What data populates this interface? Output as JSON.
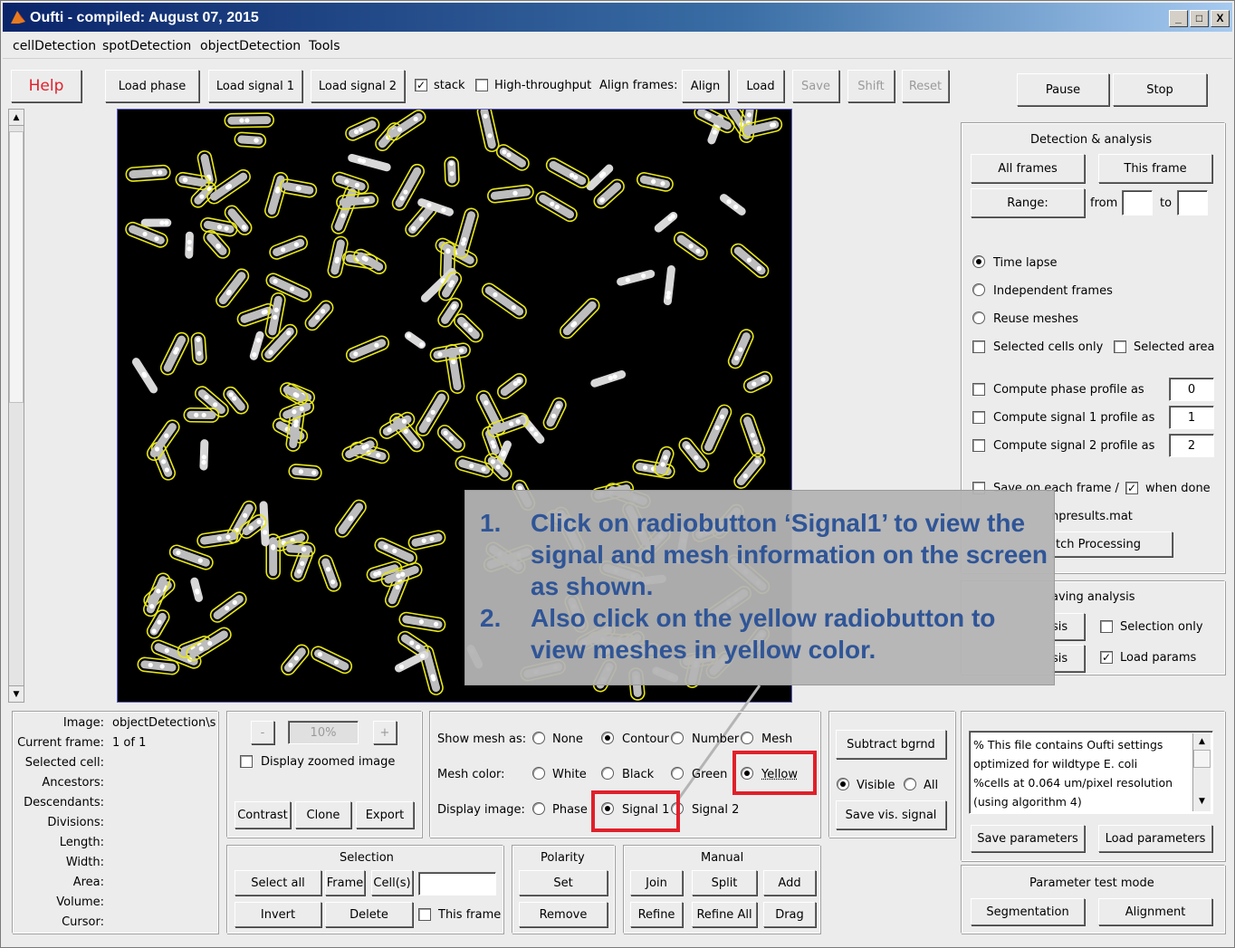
{
  "window": {
    "title": "Oufti - compiled: August 07, 2015",
    "controls": [
      "_",
      "□",
      "X"
    ]
  },
  "menu": [
    "cellDetection",
    "spotDetection",
    "objectDetection",
    "Tools"
  ],
  "toolbar": {
    "help": "Help",
    "load_phase": "Load phase",
    "load_signal1": "Load signal 1",
    "load_signal2": "Load signal 2",
    "stack": "stack",
    "high_throughput": "High-throughput",
    "align_frames": "Align frames:",
    "align": "Align",
    "load": "Load",
    "save": "Save",
    "shift": "Shift",
    "reset": "Reset",
    "pause": "Pause",
    "stop": "Stop"
  },
  "detection": {
    "title": "Detection & analysis",
    "all_frames": "All frames",
    "this_frame": "This frame",
    "range": "Range:",
    "from": "from",
    "to": "to",
    "time_lapse": "Time lapse",
    "independent_frames": "Independent frames",
    "reuse_meshes": "Reuse meshes",
    "selected_cells_only": "Selected cells only",
    "selected_area": "Selected area",
    "compute_phase": "Compute phase profile as",
    "compute_sig1": "Compute signal 1 profile as",
    "compute_sig2": "Compute signal 2 profile as",
    "phase_val": "0",
    "sig1_val": "1",
    "sig2_val": "2",
    "save_each_frame": "Save on each frame /",
    "when_done": "when done",
    "results_file": "npresults.mat",
    "batch": "tch Processing",
    "saving_analysis": "aving analysis",
    "sis1": "sis",
    "sis2": "sis",
    "selection_only": "Selection only",
    "load_params": "Load params"
  },
  "callout": {
    "items": [
      {
        "n": "1.",
        "text": "Click on radiobutton ‘Signal1’ to view the signal and mesh information on the screen as shown."
      },
      {
        "n": "2.",
        "text": "Also click on the yellow radiobutton to view meshes in yellow color."
      }
    ]
  },
  "info": {
    "labels": [
      "Image:",
      "Current frame:",
      "Selected cell:",
      "Ancestors:",
      "Descendants:",
      "Divisions:",
      "Length:",
      "Width:",
      "Area:",
      "Volume:",
      "Cursor:"
    ],
    "image_value": "objectDetection\\s",
    "frame_value": "1 of 1"
  },
  "zoom": {
    "minus": "-",
    "value": "10%",
    "plus": "+",
    "display_zoomed": "Display zoomed image",
    "contrast": "Contrast",
    "clone": "Clone",
    "export": "Export"
  },
  "display": {
    "show_mesh_as": "Show mesh as:",
    "none": "None",
    "contour": "Contour",
    "number": "Number",
    "mesh": "Mesh",
    "mesh_color": "Mesh color:",
    "white": "White",
    "black": "Black",
    "green": "Green",
    "yellow": "Yellow",
    "display_image": "Display image:",
    "phase": "Phase",
    "signal1": "Signal 1",
    "signal2": "Signal 2"
  },
  "subtract": {
    "subtract_bgrnd": "Subtract bgrnd",
    "visible": "Visible",
    "all": "All",
    "save_vis_signal": "Save vis. signal"
  },
  "params": {
    "text_lines": [
      "% This file contains Oufti settings",
      "optimized for wildtype E. coli",
      "%cells at 0.064 um/pixel resolution",
      "(using algorithm 4)"
    ],
    "save": "Save parameters",
    "load": "Load parameters",
    "test_mode": "Parameter test mode",
    "segmentation": "Segmentation",
    "alignment": "Alignment"
  },
  "selection": {
    "title": "Selection",
    "select_all": "Select all",
    "frame": "Frame",
    "cells": "Cell(s)",
    "invert": "Invert",
    "delete": "Delete",
    "this_frame": "This frame"
  },
  "polarity": {
    "title": "Polarity",
    "set": "Set",
    "remove": "Remove"
  },
  "manual": {
    "title": "Manual",
    "join": "Join",
    "split": "Split",
    "add": "Add",
    "refine": "Refine",
    "refine_all": "Refine All",
    "drag": "Drag"
  },
  "colors": {
    "mesh": "#e6e61a",
    "callout_text": "#2f5597",
    "highlight": "#e0202a",
    "help": "#e0202a"
  }
}
